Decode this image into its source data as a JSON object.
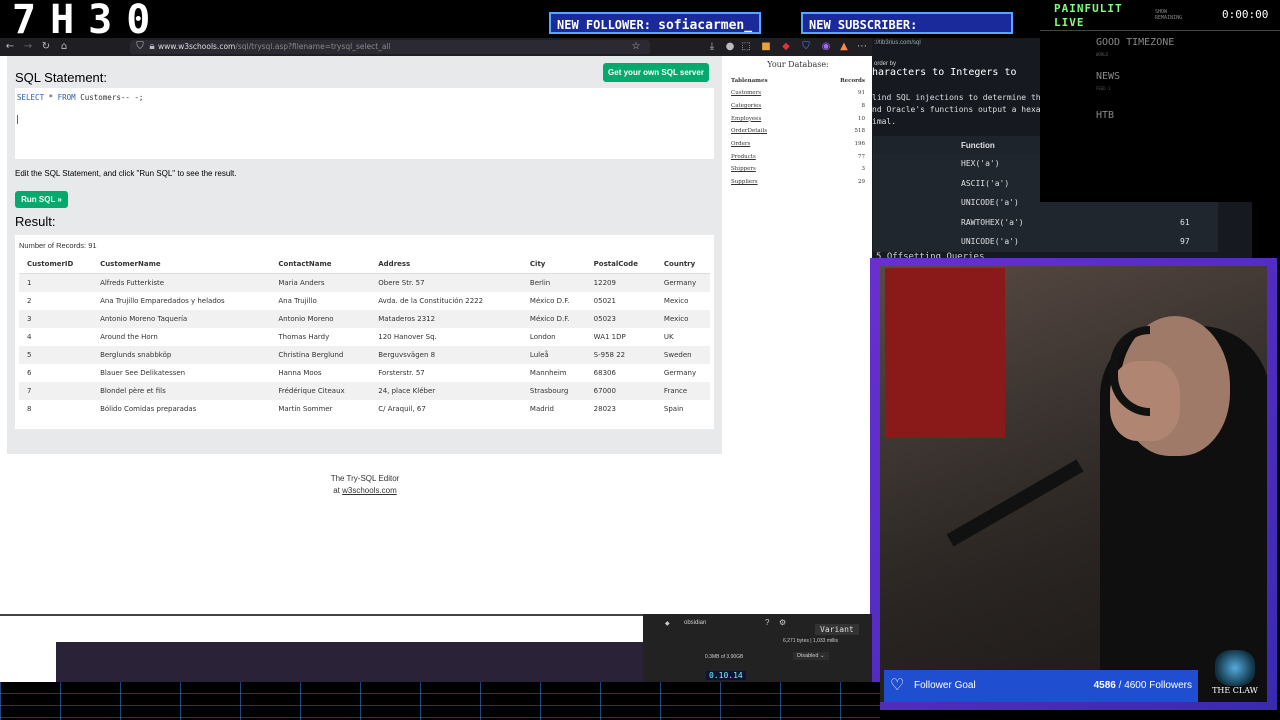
{
  "stream": {
    "clock": "7H30",
    "alerts": [
      {
        "label": "NEW FOLLOWER:",
        "value": "sofiacarmen_"
      },
      {
        "label": "NEW SUBSCRIBER:",
        "value": ""
      }
    ],
    "brand_line1": "PAINFULIT",
    "brand_line2": "LIVE",
    "show_remaining_l1": "SHOW",
    "show_remaining_l2": "REMAINING",
    "timer": "0:00:00",
    "side_items": [
      {
        "label": "GOOD TIMEZONE",
        "sub": "WORLD"
      },
      {
        "label": "NEWS",
        "sub": "FEED 1"
      },
      {
        "label": "HTB",
        "sub": ""
      }
    ],
    "follower_goal": {
      "label": "Follower Goal",
      "current": "4586",
      "target": "4600 Followers",
      "separator": "/"
    },
    "logo_text": "THE CLAW"
  },
  "browser": {
    "url_host": "www.w3schools.com",
    "url_path": "/sql/trysql.asp?filename=trysql_select_all",
    "colors": {
      "accent": "#04aa6d",
      "editor_bg": "#e7e9eb"
    }
  },
  "editor": {
    "heading": "SQL Statement:",
    "get_server_label": "Get your own SQL server",
    "sql_keyword1": "SELECT",
    "sql_star": " * ",
    "sql_keyword2": "FROM",
    "sql_rest": " Customers-- -;",
    "hint": "Edit the SQL Statement, and click \"Run SQL\" to see the result.",
    "run_label": "Run SQL »",
    "result_heading": "Result:",
    "record_count": "Number of Records: 91",
    "footer_line1": "The Try-SQL Editor",
    "footer_at": "at ",
    "footer_link": "w3schools.com"
  },
  "result_table": {
    "columns": [
      "CustomerID",
      "CustomerName",
      "ContactName",
      "Address",
      "City",
      "PostalCode",
      "Country"
    ],
    "rows": [
      [
        "1",
        "Alfreds Futterkiste",
        "Maria Anders",
        "Obere Str. 57",
        "Berlin",
        "12209",
        "Germany"
      ],
      [
        "2",
        "Ana Trujillo Emparedados y helados",
        "Ana Trujillo",
        "Avda. de la Constitución 2222",
        "México D.F.",
        "05021",
        "Mexico"
      ],
      [
        "3",
        "Antonio Moreno Taquería",
        "Antonio Moreno",
        "Mataderos 2312",
        "México D.F.",
        "05023",
        "Mexico"
      ],
      [
        "4",
        "Around the Horn",
        "Thomas Hardy",
        "120 Hanover Sq.",
        "London",
        "WA1 1DP",
        "UK"
      ],
      [
        "5",
        "Berglunds snabbköp",
        "Christina Berglund",
        "Berguvsvägen 8",
        "Luleå",
        "S-958 22",
        "Sweden"
      ],
      [
        "6",
        "Blauer See Delikatessen",
        "Hanna Moos",
        "Forsterstr. 57",
        "Mannheim",
        "68306",
        "Germany"
      ],
      [
        "7",
        "Blondel père et fils",
        "Frédérique Citeaux",
        "24, place Kléber",
        "Strasbourg",
        "67000",
        "France"
      ],
      [
        "8",
        "Bólido Comidas preparadas",
        "Martín Sommer",
        "C/ Araquil, 67",
        "Madrid",
        "28023",
        "Spain"
      ]
    ]
  },
  "database": {
    "title": "Your Database:",
    "col_name": "Tablenames",
    "col_records": "Records",
    "tables": [
      {
        "name": "Customers",
        "records": "91"
      },
      {
        "name": "Categories",
        "records": "8"
      },
      {
        "name": "Employees",
        "records": "10"
      },
      {
        "name": "OrderDetails",
        "records": "518"
      },
      {
        "name": "Orders",
        "records": "196"
      },
      {
        "name": "Products",
        "records": "77"
      },
      {
        "name": "Shippers",
        "records": "3"
      },
      {
        "name": "Suppliers",
        "records": "29"
      }
    ]
  },
  "htb": {
    "url": "://tib3rius.com/sql",
    "order_by": "order by",
    "heading": "haracters to Integers to",
    "text_lines": "lind SQL injections to determine th\nnd Oracle's functions output a hexa\nimal.",
    "func_header": "Function",
    "functions": [
      {
        "f": "HEX('a')",
        "v": ""
      },
      {
        "f": "ASCII('a')",
        "v": ""
      },
      {
        "f": "UNICODE('a')",
        "v": ""
      },
      {
        "f": "RAWTOHEX('a')",
        "v": "61"
      },
      {
        "f": "UNICODE('a')",
        "v": "97"
      }
    ],
    "subheading": "5 Offsetting Queries"
  },
  "bottom": {
    "obsidian_label": "obsidian",
    "variant_label": "Variant",
    "perf_line1": "6,271 bytes | 1,033 millis",
    "mem_label": "0.3MB of 3.90GB",
    "disabled_label": "Disabled",
    "version": "0.10.14"
  }
}
